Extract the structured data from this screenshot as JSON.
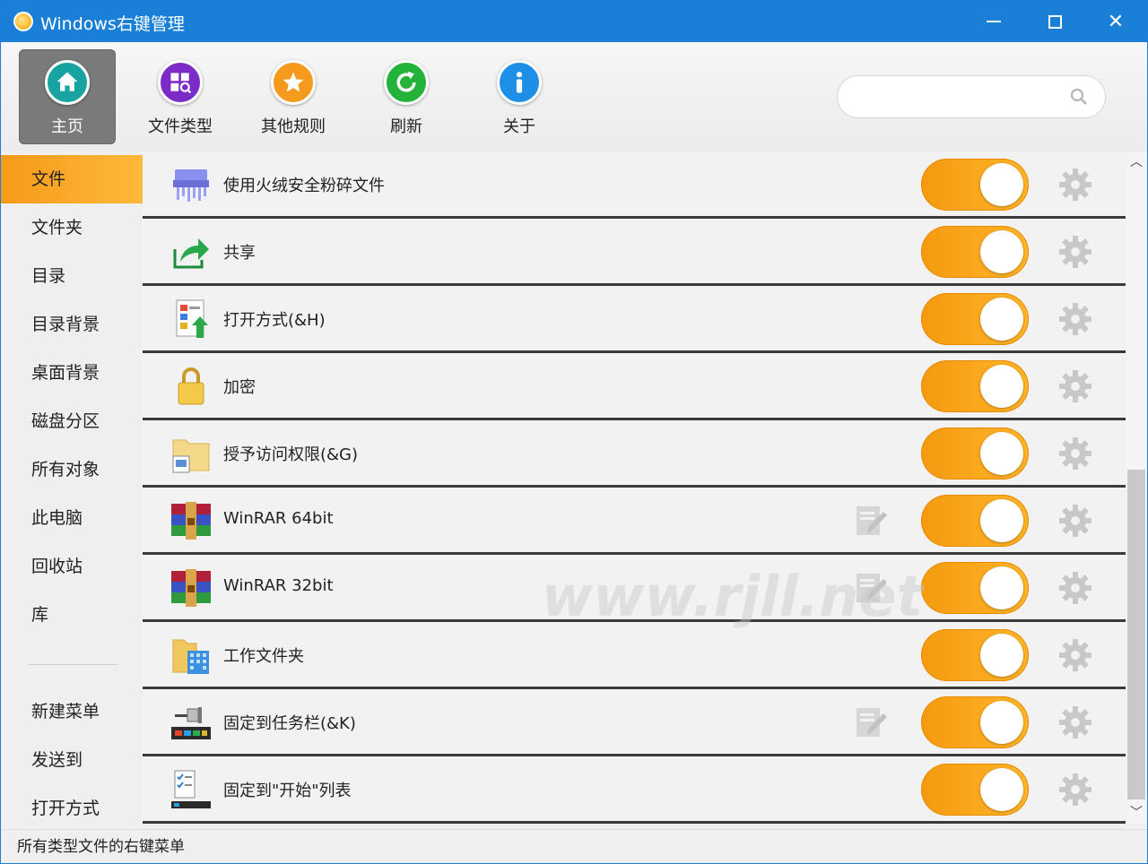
{
  "window": {
    "title": "Windows右键管理"
  },
  "toolbar": {
    "buttons": [
      {
        "label": "主页",
        "icon": "home-icon",
        "active": true
      },
      {
        "label": "文件类型",
        "icon": "file-type-icon",
        "active": false
      },
      {
        "label": "其他规则",
        "icon": "star-icon",
        "active": false
      },
      {
        "label": "刷新",
        "icon": "refresh-icon",
        "active": false
      },
      {
        "label": "关于",
        "icon": "info-icon",
        "active": false
      }
    ],
    "search": {
      "value": "",
      "placeholder": ""
    }
  },
  "sidebar": {
    "items": [
      {
        "label": "文件",
        "active": true
      },
      {
        "label": "文件夹"
      },
      {
        "label": "目录"
      },
      {
        "label": "目录背景"
      },
      {
        "label": "桌面背景"
      },
      {
        "label": "磁盘分区"
      },
      {
        "label": "所有对象"
      },
      {
        "label": "此电脑"
      },
      {
        "label": "回收站"
      },
      {
        "label": "库"
      },
      {
        "label": "新建菜单"
      },
      {
        "label": "发送到"
      },
      {
        "label": "打开方式"
      }
    ]
  },
  "list": {
    "rows": [
      {
        "label": "使用火绒安全粉碎文件",
        "icon": "shredder-icon",
        "enabled": true,
        "editable": false
      },
      {
        "label": "共享",
        "icon": "share-icon",
        "enabled": true,
        "editable": false
      },
      {
        "label": "打开方式(&H)",
        "icon": "open-with-icon",
        "enabled": true,
        "editable": false
      },
      {
        "label": "加密",
        "icon": "lock-icon",
        "enabled": true,
        "editable": false
      },
      {
        "label": "授予访问权限(&G)",
        "icon": "access-folder-icon",
        "enabled": true,
        "editable": false
      },
      {
        "label": "WinRAR 64bit",
        "icon": "winrar-icon",
        "enabled": true,
        "editable": true
      },
      {
        "label": "WinRAR 32bit",
        "icon": "winrar-icon",
        "enabled": true,
        "editable": true
      },
      {
        "label": "工作文件夹",
        "icon": "work-folder-icon",
        "enabled": true,
        "editable": false
      },
      {
        "label": "固定到任务栏(&K)",
        "icon": "taskbar-pin-icon",
        "enabled": true,
        "editable": true
      },
      {
        "label": "固定到\"开始\"列表",
        "icon": "start-list-icon",
        "enabled": true,
        "editable": false
      }
    ]
  },
  "watermark": "www.rjll.net",
  "status": {
    "text": "所有类型文件的右键菜单"
  },
  "colors": {
    "accent": "#1a7fd6",
    "toggle": "#f7a21b",
    "active_side": "#f79a1a"
  }
}
